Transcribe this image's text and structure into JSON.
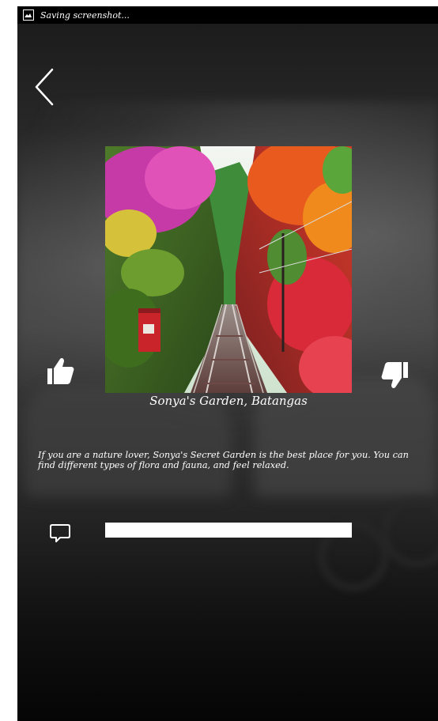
{
  "status_bar": {
    "message": "Saving screenshot..."
  },
  "icons": {
    "status": "screenshot-icon",
    "back": "chevron-left-icon",
    "like": "thumbs-up-icon",
    "dislike": "thumbs-down-icon",
    "comment": "comment-icon"
  },
  "place": {
    "title": "Sonya's Garden, Batangas",
    "description": "If you are a nature lover, Sonya's Secret Garden is the best place for you. You can find different types of flora and fauna, and feel relaxed."
  },
  "comment": {
    "value": "",
    "placeholder": ""
  },
  "colors": {
    "text": "#ffffff",
    "status_bar": "#000000",
    "input_bg": "#ffffff"
  }
}
